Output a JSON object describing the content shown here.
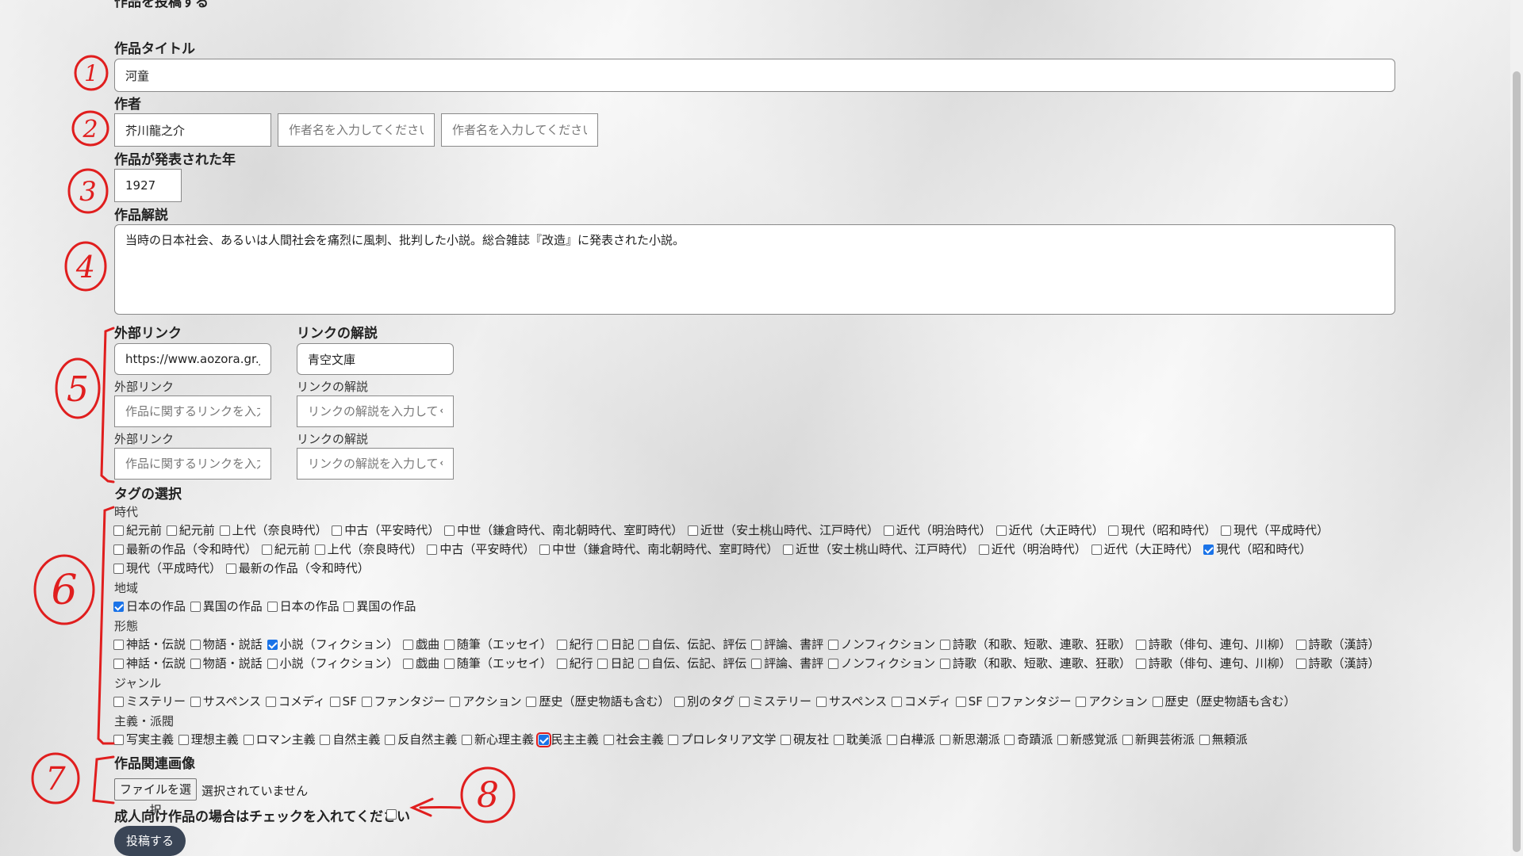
{
  "page_heading": "作品を投稿する",
  "title": {
    "label": "作品タイトル",
    "value": "河童"
  },
  "author": {
    "label": "作者",
    "value": "芥川龍之介",
    "placeholder": "作者名を入力してください"
  },
  "year": {
    "label": "作品が発表された年",
    "value": "1927"
  },
  "description": {
    "label": "作品解説",
    "value": "当時の日本社会、あるいは人間社会を痛烈に風刺、批判した小説。総合雑誌『改造』に発表された小説。"
  },
  "links": {
    "link_label": "外部リンク",
    "desc_label": "リンクの解説",
    "link_placeholder": "作品に関するリンクを入力してください",
    "desc_placeholder": "リンクの解説を入力してください",
    "rows": [
      {
        "link": "https://www.aozora.gr.jp",
        "desc": "青空文庫"
      },
      {
        "link": "",
        "desc": ""
      },
      {
        "link": "",
        "desc": ""
      }
    ]
  },
  "tags": {
    "label": "タグの選択",
    "era": {
      "label": "時代",
      "items": [
        {
          "label": "紀元前",
          "checked": false
        },
        {
          "label": "紀元前",
          "checked": false
        },
        {
          "label": "上代（奈良時代）",
          "checked": false
        },
        {
          "label": "中古（平安時代）",
          "checked": false
        },
        {
          "label": "中世（鎌倉時代、南北朝時代、室町時代）",
          "checked": false
        },
        {
          "label": "近世（安土桃山時代、江戸時代）",
          "checked": false
        },
        {
          "label": "近代（明治時代）",
          "checked": false
        },
        {
          "label": "近代（大正時代）",
          "checked": false
        },
        {
          "label": "現代（昭和時代）",
          "checked": false
        },
        {
          "label": "現代（平成時代）",
          "checked": false
        },
        {
          "label": "最新の作品（令和時代）",
          "checked": false
        },
        {
          "label": "紀元前",
          "checked": false
        },
        {
          "label": "上代（奈良時代）",
          "checked": false
        },
        {
          "label": "中古（平安時代）",
          "checked": false
        },
        {
          "label": "中世（鎌倉時代、南北朝時代、室町時代）",
          "checked": false
        },
        {
          "label": "近世（安土桃山時代、江戸時代）",
          "checked": false
        },
        {
          "label": "近代（明治時代）",
          "checked": false
        },
        {
          "label": "近代（大正時代）",
          "checked": false
        },
        {
          "label": "現代（昭和時代）",
          "checked": true
        },
        {
          "label": "現代（平成時代）",
          "checked": false
        },
        {
          "label": "最新の作品（令和時代）",
          "checked": false
        }
      ]
    },
    "region": {
      "label": "地域",
      "items": [
        {
          "label": "日本の作品",
          "checked": true
        },
        {
          "label": "異国の作品",
          "checked": false
        },
        {
          "label": "日本の作品",
          "checked": false
        },
        {
          "label": "異国の作品",
          "checked": false
        }
      ]
    },
    "form": {
      "label": "形態",
      "items": [
        {
          "label": "神話・伝説",
          "checked": false
        },
        {
          "label": "物語・説話",
          "checked": false
        },
        {
          "label": "小説（フィクション）",
          "checked": true
        },
        {
          "label": "戯曲",
          "checked": false
        },
        {
          "label": "随筆（エッセイ）",
          "checked": false
        },
        {
          "label": "紀行",
          "checked": false
        },
        {
          "label": "日記",
          "checked": false
        },
        {
          "label": "自伝、伝記、評伝",
          "checked": false
        },
        {
          "label": "評論、書評",
          "checked": false
        },
        {
          "label": "ノンフィクション",
          "checked": false
        },
        {
          "label": "詩歌（和歌、短歌、連歌、狂歌）",
          "checked": false
        },
        {
          "label": "詩歌（俳句、連句、川柳）",
          "checked": false
        },
        {
          "label": "詩歌（漢詩）",
          "checked": false
        },
        {
          "label": "神話・伝説",
          "checked": false
        },
        {
          "label": "物語・説話",
          "checked": false
        },
        {
          "label": "小説（フィクション）",
          "checked": false
        },
        {
          "label": "戯曲",
          "checked": false
        },
        {
          "label": "随筆（エッセイ）",
          "checked": false
        },
        {
          "label": "紀行",
          "checked": false
        },
        {
          "label": "日記",
          "checked": false
        },
        {
          "label": "自伝、伝記、評伝",
          "checked": false
        },
        {
          "label": "評論、書評",
          "checked": false
        },
        {
          "label": "ノンフィクション",
          "checked": false
        },
        {
          "label": "詩歌（和歌、短歌、連歌、狂歌）",
          "checked": false
        },
        {
          "label": "詩歌（俳句、連句、川柳）",
          "checked": false
        },
        {
          "label": "詩歌（漢詩）",
          "checked": false
        }
      ]
    },
    "genre": {
      "label": "ジャンル",
      "items": [
        {
          "label": "ミステリー",
          "checked": false
        },
        {
          "label": "サスペンス",
          "checked": false
        },
        {
          "label": "コメディ",
          "checked": false
        },
        {
          "label": "SF",
          "checked": false
        },
        {
          "label": "ファンタジー",
          "checked": false
        },
        {
          "label": "アクション",
          "checked": false
        },
        {
          "label": "歴史（歴史物語も含む）",
          "checked": false
        },
        {
          "label": "別のタグ",
          "checked": false
        },
        {
          "label": "ミステリー",
          "checked": false
        },
        {
          "label": "サスペンス",
          "checked": false
        },
        {
          "label": "コメディ",
          "checked": false
        },
        {
          "label": "SF",
          "checked": false
        },
        {
          "label": "ファンタジー",
          "checked": false
        },
        {
          "label": "アクション",
          "checked": false
        },
        {
          "label": "歴史（歴史物語も含む）",
          "checked": false
        }
      ]
    },
    "school": {
      "label": "主義・派閥",
      "items": [
        {
          "label": "写実主義",
          "checked": false
        },
        {
          "label": "理想主義",
          "checked": false
        },
        {
          "label": "ロマン主義",
          "checked": false
        },
        {
          "label": "自然主義",
          "checked": false
        },
        {
          "label": "反自然主義",
          "checked": false
        },
        {
          "label": "新心理主義",
          "checked": false
        },
        {
          "label": "民主主義",
          "checked": true,
          "highlight": true
        },
        {
          "label": "社会主義",
          "checked": false
        },
        {
          "label": "プロレタリア文学",
          "checked": false
        },
        {
          "label": "硯友社",
          "checked": false
        },
        {
          "label": "耽美派",
          "checked": false
        },
        {
          "label": "白樺派",
          "checked": false
        },
        {
          "label": "新思潮派",
          "checked": false
        },
        {
          "label": "奇蹟派",
          "checked": false
        },
        {
          "label": "新感覚派",
          "checked": false
        },
        {
          "label": "新興芸術派",
          "checked": false
        },
        {
          "label": "無頼派",
          "checked": false
        }
      ]
    }
  },
  "image": {
    "label": "作品関連画像",
    "button": "ファイルを選択",
    "status": "選択されていません"
  },
  "adult": {
    "label": "成人向け作品の場合はチェックを入れてください",
    "checked": false
  },
  "submit": {
    "label": "投稿する"
  },
  "annotations": [
    "1",
    "2",
    "3",
    "4",
    "5",
    "6",
    "7",
    "8"
  ],
  "colors": {
    "accent": "#1a73e8",
    "annotation": "#e01e1e",
    "submit_bg": "#3a4556"
  }
}
